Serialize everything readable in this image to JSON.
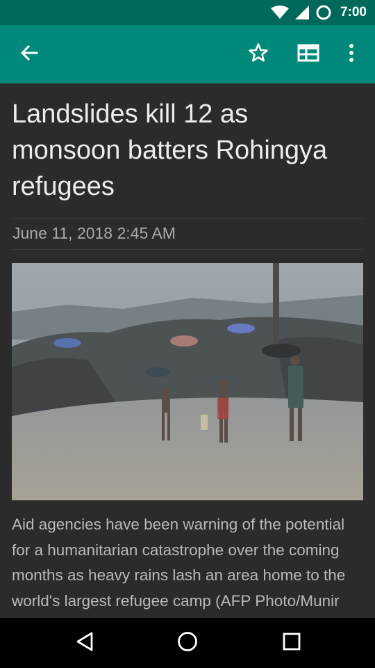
{
  "status_bar": {
    "time": "7:00",
    "icons": [
      "wifi-icon",
      "cellular-signal-icon",
      "data-saver-icon"
    ]
  },
  "app_bar": {
    "background_color": "#00897b",
    "status_color": "#00695c",
    "actions": [
      "back-arrow-icon",
      "star-icon",
      "layout-icon",
      "more-vert-icon"
    ]
  },
  "article": {
    "headline": "Landslides kill 12 as monsoon batters Rohingya refugees",
    "date": "June 11, 2018 2:45 AM",
    "image": {
      "description_icon": "news-photo",
      "alt": ""
    },
    "caption": "Aid agencies have been warning of the potential for a humanitarian catastrophe over the coming months as heavy rains lash an area home to the world's largest refugee camp (AFP Photo/Munir"
  },
  "nav_bar": {
    "buttons": [
      "nav-back-icon",
      "nav-home-icon",
      "nav-recents-icon"
    ]
  }
}
